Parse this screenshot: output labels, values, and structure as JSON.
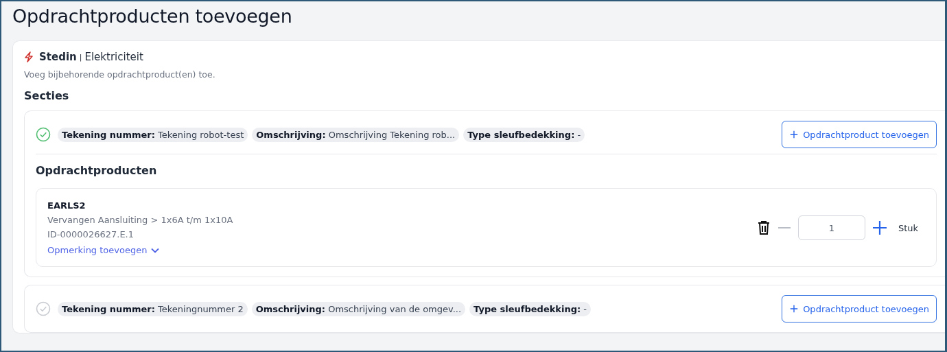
{
  "page": {
    "title": "Opdrachtproducten toevoegen"
  },
  "header": {
    "company": "Stedin",
    "separator": "|",
    "category": "Elektriciteit",
    "description": "Voeg bijbehorende opdrachtproduct(en) toe."
  },
  "sections_title": "Secties",
  "sections": [
    {
      "complete": true,
      "tags": [
        {
          "label": "Tekening nummer:",
          "value": "Tekening robot-test"
        },
        {
          "label": "Omschrijving:",
          "value": "Omschrijving Tekening rob..."
        },
        {
          "label": "Type sleufbedekking:",
          "value": "-"
        }
      ],
      "add_button": "Opdrachtproduct toevoegen",
      "products_title": "Opdrachtproducten",
      "products": [
        {
          "code": "EARLS2",
          "description": "Vervangen Aansluiting > 1x6A t/m 1x10A",
          "id": "ID-0000026627.E.1",
          "remark_link": "Opmerking toevoegen",
          "quantity": "1",
          "minus_disabled": true,
          "unit": "Stuk"
        }
      ]
    },
    {
      "complete": false,
      "tags": [
        {
          "label": "Tekening nummer:",
          "value": "Tekeningnummer 2"
        },
        {
          "label": "Omschrijving:",
          "value": "Omschrijving van de omgev..."
        },
        {
          "label": "Type sleufbedekking:",
          "value": "-"
        }
      ],
      "add_button": "Opdrachtproduct toevoegen"
    }
  ]
}
